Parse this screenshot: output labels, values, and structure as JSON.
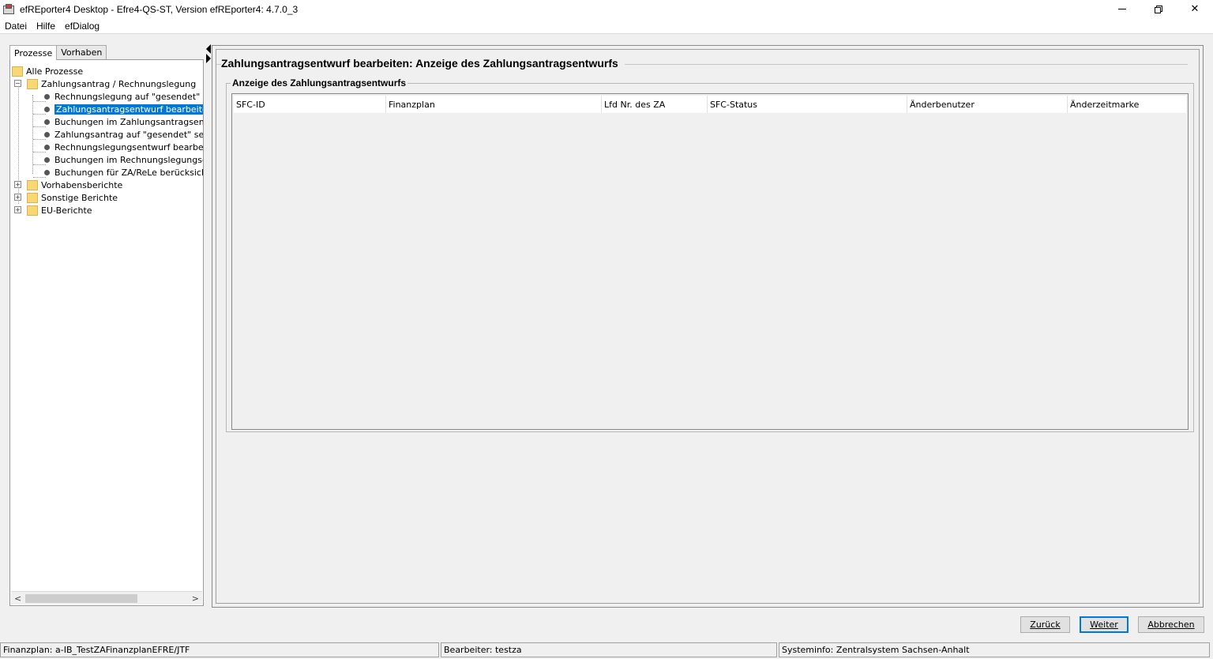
{
  "window": {
    "title": "efREporter4 Desktop - Efre4-QS-ST, Version efREporter4: 4.7.0_3"
  },
  "menu": [
    "Datei",
    "Hilfe",
    "efDialog"
  ],
  "sidebar": {
    "tabs": [
      "Prozesse",
      "Vorhaben"
    ],
    "active_tab": "Prozesse",
    "tree": {
      "root": "Alle Prozesse",
      "group1": {
        "label": "Zahlungsantrag / Rechnungslegung",
        "expander": "−",
        "children": [
          "Rechnungslegung auf \"gesendet\" setze",
          "Zahlungsantragsentwurf bearbeiten",
          "Buchungen im Zahlungsantragsentwurf",
          "Zahlungsantrag auf \"gesendet\" setzen",
          "Rechnungslegungsentwurf bearbeiten",
          "Buchungen im Rechnungslegungsentwu",
          "Buchungen für ZA/ReLe berücksichtige"
        ],
        "selected_index": 1
      },
      "collapsed": [
        {
          "label": "Vorhabensberichte",
          "expander": "+"
        },
        {
          "label": "Sonstige Berichte",
          "expander": "+"
        },
        {
          "label": "EU-Berichte",
          "expander": "+"
        }
      ]
    },
    "scroll_left": "<",
    "scroll_right": ">"
  },
  "main": {
    "title": "Zahlungsantragsentwurf bearbeiten: Anzeige des Zahlungsantragsentwurfs",
    "group_title": "Anzeige des Zahlungsantragsentwurfs",
    "table": {
      "columns": [
        "SFC-ID",
        "Finanzplan",
        "Lfd Nr. des ZA",
        "SFC-Status",
        "Änderbenutzer",
        "Änderzeitmarke"
      ],
      "rows": []
    }
  },
  "buttons": {
    "back": "Zurück",
    "next": "Weiter",
    "cancel": "Abbrechen"
  },
  "status": {
    "finanzplan": "Finanzplan: a-IB_TestZAFinanzplanEFRE/JTF",
    "bearbeiter": "Bearbeiter: testza",
    "systeminfo": "Systeminfo: Zentralsystem Sachsen-Anhalt"
  },
  "colors": {
    "selection": "#0078d7",
    "folder": "#f8d775",
    "background": "#f0f0f0"
  }
}
